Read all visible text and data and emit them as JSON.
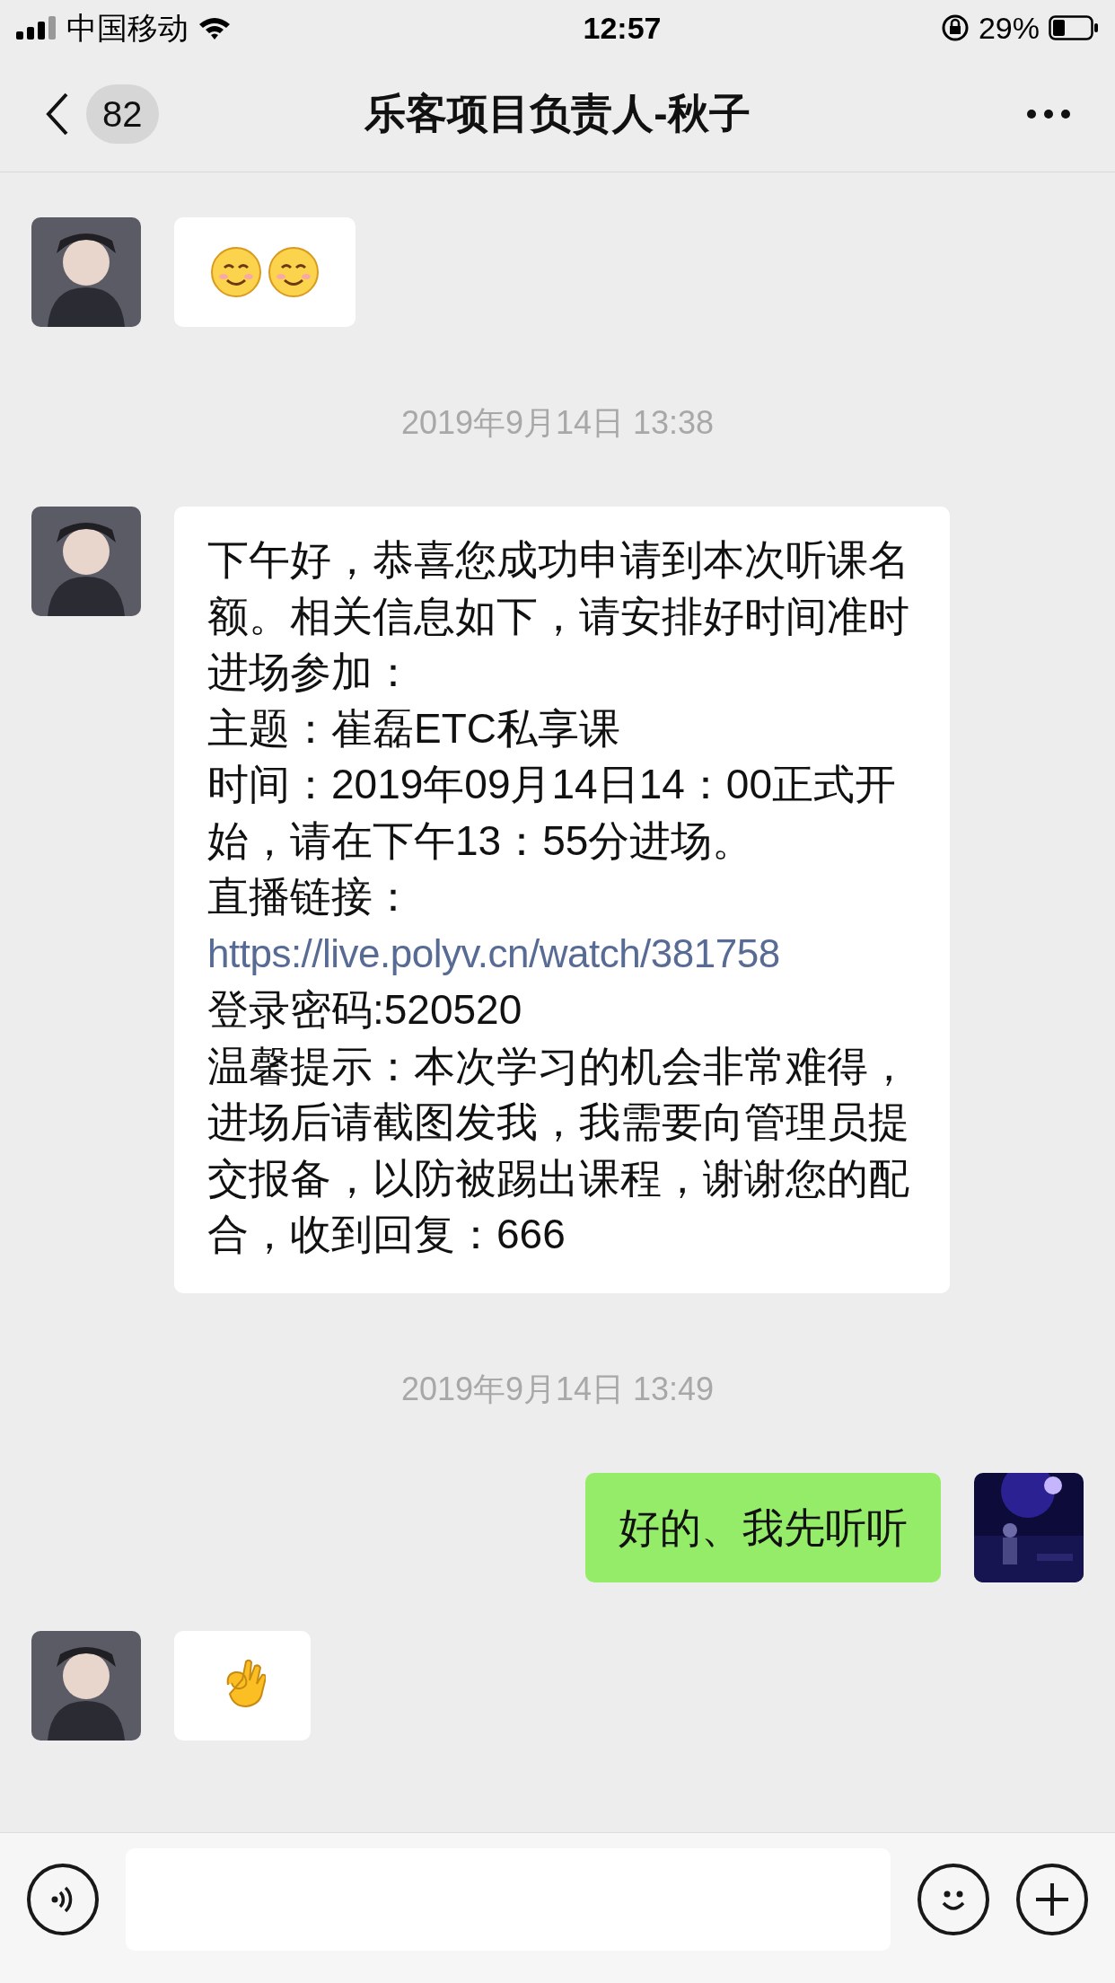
{
  "status_bar": {
    "carrier": "中国移动",
    "time": "12:57",
    "battery": "29%"
  },
  "header": {
    "unread_count": "82",
    "title": "乐客项目负责人-秋子"
  },
  "messages": [
    {
      "kind": "smiles",
      "outgoing": false
    },
    {
      "kind": "timestamp",
      "text": "2019年9月14日 13:38"
    },
    {
      "kind": "text",
      "outgoing": false,
      "paragraphs": [
        {
          "kind": "text",
          "text": "下午好，恭喜您成功申请到本次听课名额。相关信息如下，请安排好时间准时进场参加："
        },
        {
          "kind": "text",
          "text": "主题：崔磊ETC私享课"
        },
        {
          "kind": "text",
          "text": "时间：2019年09月14日14：00正式开始，请在下午13：55分进场。"
        },
        {
          "kind": "text",
          "text": "直播链接："
        },
        {
          "kind": "link",
          "text": "https://live.polyv.cn/watch/381758"
        },
        {
          "kind": "text",
          "text": "登录密码:520520"
        },
        {
          "kind": "text",
          "text": "温馨提示：本次学习的机会非常难得，进场后请截图发我，我需要向管理员提交报备，以防被踢出课程，谢谢您的配合，收到回复：666"
        }
      ]
    },
    {
      "kind": "timestamp",
      "text": "2019年9月14日 13:49"
    },
    {
      "kind": "text",
      "outgoing": true,
      "paragraphs": [
        {
          "kind": "text",
          "text": "好的、我先听听"
        }
      ]
    },
    {
      "kind": "ok_hand",
      "outgoing": false
    }
  ]
}
